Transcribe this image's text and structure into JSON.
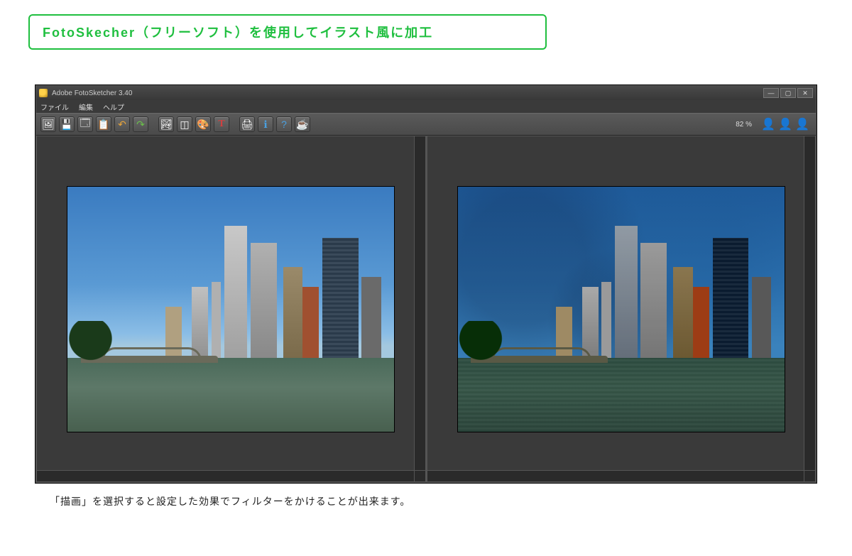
{
  "heading": "FotoSkecher（フリーソフト）を使用してイラスト風に加工",
  "app": {
    "title": "Adobe FotoSketcher 3.40",
    "menu": [
      "ファイル",
      "編集",
      "ヘルプ"
    ],
    "toolbar_icons": [
      {
        "name": "open-image-icon",
        "glyph": "🖼"
      },
      {
        "name": "save-icon",
        "glyph": "💾"
      },
      {
        "name": "frame-icon",
        "glyph": "🗔"
      },
      {
        "name": "copy-icon",
        "glyph": "📋"
      },
      {
        "name": "undo-icon",
        "glyph": "↶",
        "color": "#e8a53a"
      },
      {
        "name": "redo-icon",
        "glyph": "↷",
        "color": "#6ac04a"
      },
      {
        "name": "sep",
        "glyph": ""
      },
      {
        "name": "picture-icon",
        "glyph": "🏞"
      },
      {
        "name": "crop-icon",
        "glyph": "◫"
      },
      {
        "name": "palette-icon",
        "glyph": "🎨"
      },
      {
        "name": "text-icon",
        "glyph": "T",
        "color": "#d04040"
      },
      {
        "name": "sep",
        "glyph": ""
      },
      {
        "name": "print-icon",
        "glyph": "🖨"
      },
      {
        "name": "info-icon",
        "glyph": "ℹ",
        "color": "#4aa0e0"
      },
      {
        "name": "help-icon",
        "glyph": "?",
        "color": "#4aa0e0"
      },
      {
        "name": "coffee-icon",
        "glyph": "☕"
      }
    ],
    "zoom": "82 %",
    "window_controls": [
      "—",
      "▢",
      "✕"
    ]
  },
  "caption": "「描画」を選択すると設定した効果でフィルターをかけることが出来ます。"
}
